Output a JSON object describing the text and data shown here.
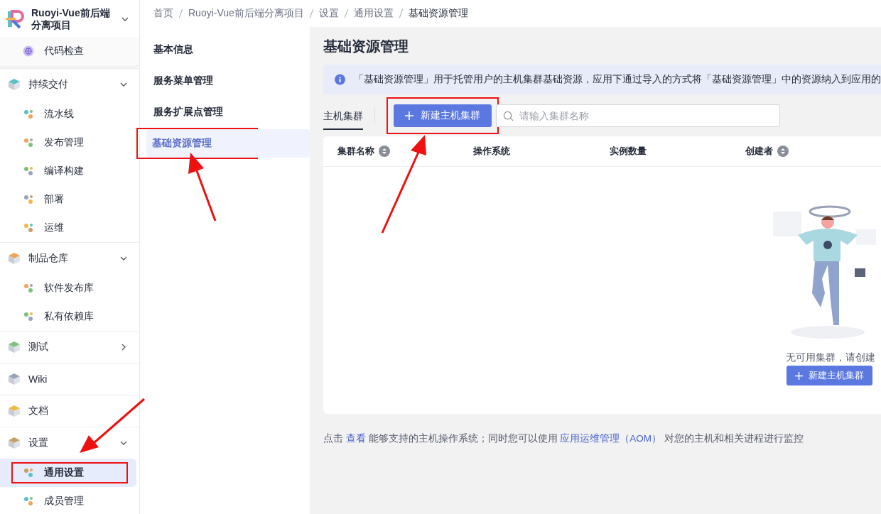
{
  "project": {
    "name": "Ruoyi-Vue前后端分离项目",
    "expanded": true,
    "children": [
      {
        "label": "代码检查",
        "selected": false,
        "annotated": false
      }
    ]
  },
  "nav": [
    {
      "label": "持续交付",
      "expanded": true,
      "children": [
        {
          "label": "流水线",
          "selected": false,
          "annotated": false
        },
        {
          "label": "发布管理",
          "selected": false,
          "annotated": false
        },
        {
          "label": "编译构建",
          "selected": false,
          "annotated": false
        },
        {
          "label": "部署",
          "selected": false,
          "annotated": false
        },
        {
          "label": "运维",
          "selected": false,
          "annotated": false
        }
      ]
    },
    {
      "label": "制品仓库",
      "expanded": true,
      "children": [
        {
          "label": "软件发布库",
          "selected": false,
          "annotated": false
        },
        {
          "label": "私有依赖库",
          "selected": false,
          "annotated": false
        }
      ]
    },
    {
      "label": "测试",
      "expanded": false
    },
    {
      "label": "Wiki"
    },
    {
      "label": "文档"
    },
    {
      "label": "设置",
      "expanded": true,
      "children": [
        {
          "label": "通用设置",
          "selected": true,
          "annotated": true
        },
        {
          "label": "成员管理",
          "selected": false,
          "annotated": false
        }
      ]
    }
  ],
  "breadcrumb": [
    "首页",
    "Ruoyi-Vue前后端分离项目",
    "设置",
    "通用设置",
    "基础资源管理"
  ],
  "submenu": [
    {
      "label": "基本信息",
      "selected": false,
      "annotated": false
    },
    {
      "label": "服务菜单管理",
      "selected": false,
      "annotated": false
    },
    {
      "label": "服务扩展点管理",
      "selected": false,
      "annotated": false
    },
    {
      "label": "基础资源管理",
      "selected": true,
      "annotated": true
    }
  ],
  "page_title": "基础资源管理",
  "info_banner": "「基础资源管理」用于托管用户的主机集群基础资源，应用下通过导入的方式将「基础资源管理」中的资源纳入到应用的",
  "tabs": [
    {
      "label": "主机集群",
      "selected": true
    }
  ],
  "create_button": {
    "label": "新建主机集群",
    "annotated": true
  },
  "search": {
    "placeholder": "请输入集群名称"
  },
  "table": {
    "columns": [
      {
        "label": "集群名称",
        "sortable": true
      },
      {
        "label": "操作系统",
        "sortable": false
      },
      {
        "label": "实例数量",
        "sortable": false
      },
      {
        "label": "创建者",
        "sortable": true
      }
    ]
  },
  "empty_state": {
    "message": "无可用集群，请创建",
    "button": "新建主机集群"
  },
  "note": [
    {
      "text": "点击",
      "link": false
    },
    {
      "text": "查看",
      "link": true
    },
    {
      "text": "能够支持的主机操作系统；同时您可以使用",
      "link": false
    },
    {
      "text": "应用运维管理（AOM）",
      "link": true
    },
    {
      "text": "对您的主机和相关进程进行监控",
      "link": false
    }
  ]
}
